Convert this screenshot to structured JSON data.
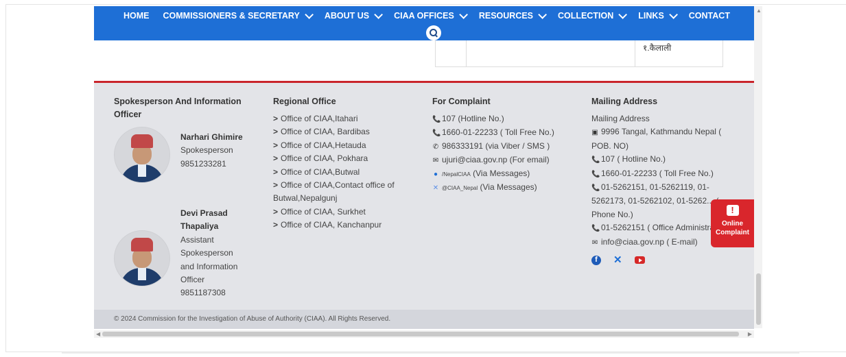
{
  "nav": {
    "items": [
      {
        "label": "HOME",
        "dropdown": false
      },
      {
        "label": "COMMISSIONERS & SECRETARY",
        "dropdown": true
      },
      {
        "label": "ABOUT US",
        "dropdown": true
      },
      {
        "label": "CIAA OFFICES",
        "dropdown": true
      },
      {
        "label": "RESOURCES",
        "dropdown": true
      },
      {
        "label": "COLLECTION",
        "dropdown": true
      },
      {
        "label": "LINKS",
        "dropdown": true
      },
      {
        "label": "CONTACT",
        "dropdown": false
      }
    ],
    "color": "#1e6fd6"
  },
  "table_fragment": {
    "cell_text": "१.कैलाली"
  },
  "footer": {
    "spokesperson": {
      "heading": "Spokesperson And Information Officer",
      "people": [
        {
          "name": "Narhari Ghimire",
          "role": "Spokesperson",
          "phone": "9851233281"
        },
        {
          "name": "Devi Prasad Thapaliya",
          "role": "Assistant Spokesperson and Information Officer",
          "phone": "9851187308"
        }
      ]
    },
    "regional": {
      "heading": "Regional Office",
      "offices": [
        "Office of CIAA,Itahari",
        "Office of CIAA, Bardibas",
        "Office of CIAA,Hetauda",
        "Office of CIAA, Pokhara",
        "Office of CIAA,Butwal",
        "Office of CIAA,Contact office of Butwal,Nepalgunj",
        "Office of CIAA, Surkhet",
        "Office of CIAA, Kanchanpur"
      ]
    },
    "complaint": {
      "heading": "For Complaint",
      "items": [
        {
          "icon": "phone-icon",
          "text": "107 (Hotline No.)"
        },
        {
          "icon": "phone-icon",
          "text": "1660-01-22233 ( Toll Free No.)"
        },
        {
          "icon": "viber-icon",
          "text": "986333191 (via Viber / SMS )"
        },
        {
          "icon": "envelope-icon",
          "text": "ujuri@ciaa.gov.np (For email)"
        },
        {
          "icon": "facebook-icon",
          "handle": "/NepalCIAA",
          "text": "(Via Messages)"
        },
        {
          "icon": "x-icon",
          "handle": "@CIAA_Nepal",
          "text": "(Via Messages)"
        }
      ]
    },
    "mailing": {
      "heading": "Mailing Address",
      "subheading": "Mailing Address",
      "items": [
        {
          "icon": "address-book-icon",
          "text": "9996 Tangal, Kathmandu Nepal ( POB. NO)"
        },
        {
          "icon": "phone-icon",
          "text": "107 ( Hotline No.)"
        },
        {
          "icon": "phone-icon",
          "text": "1660-01-22233 ( Toll Free No.)"
        },
        {
          "icon": "phone-icon",
          "text": "01-5262151, 01-5262119, 01-5262173, 01-5262102, 01-5262... ( Phone No.)"
        },
        {
          "icon": "phone-icon",
          "text": "01-5262151 ( Office Administration)"
        },
        {
          "icon": "envelope-icon",
          "text": "info@ciaa.gov.np ( E-mail)"
        }
      ],
      "social": [
        "facebook-icon",
        "x-icon",
        "youtube-icon"
      ]
    },
    "copyright": "© 2024 Commission for the Investigation of Abuse of Authority (CIAA). All Rights Reserved.",
    "accent": "#c9242b"
  },
  "online_complaint": {
    "line1": "Online",
    "line2": "Complaint",
    "icon": "alert-icon",
    "color": "#d9262c"
  }
}
